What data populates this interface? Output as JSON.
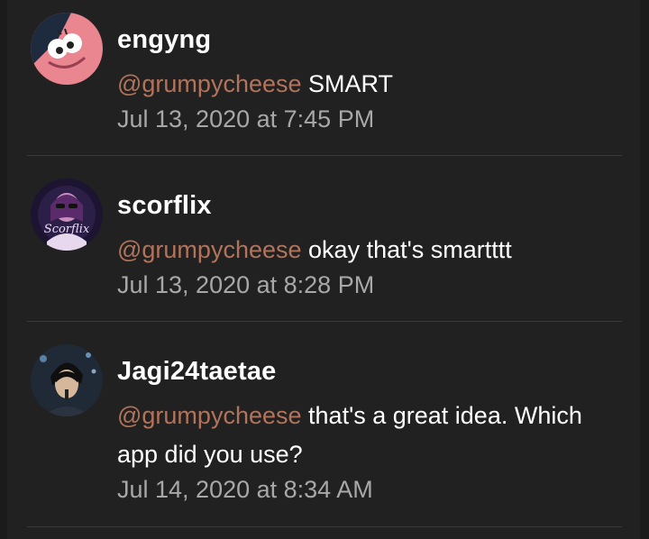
{
  "comments": [
    {
      "username": "engyng",
      "mention": "@grumpycheese",
      "text": "SMART",
      "timestamp": "Jul 13, 2020 at 7:45 PM",
      "avatar": "patrick-star-avatar"
    },
    {
      "username": "scorflix",
      "mention": "@grumpycheese",
      "text": "okay that's smartttt",
      "timestamp": "Jul 13, 2020 at 8:28 PM",
      "avatar": "scorflix-avatar",
      "avatar_text": "Scorflix"
    },
    {
      "username": "Jagi24taetae",
      "mention": "@grumpycheese",
      "text": " that's a great idea. Which app did you use?",
      "timestamp": "Jul 14, 2020 at 8:34 AM",
      "avatar": "person-photo-avatar"
    }
  ],
  "colors": {
    "background": "#212121",
    "mention": "#b2735a",
    "timestamp": "#a8a8a8",
    "divider": "#3a3a3a"
  }
}
